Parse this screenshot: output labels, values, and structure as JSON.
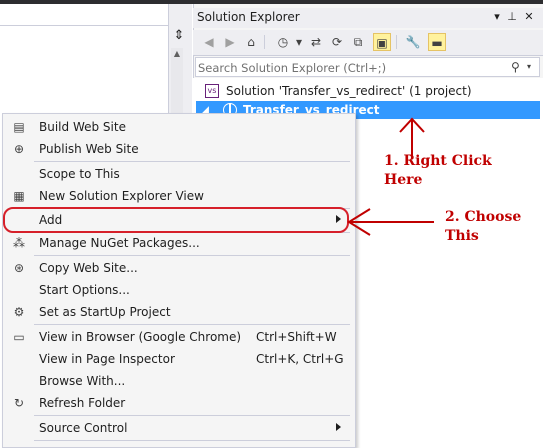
{
  "solution_explorer": {
    "title": "Solution Explorer",
    "search_placeholder": "Search Solution Explorer (Ctrl+;)",
    "tree": {
      "solution_label": "Solution 'Transfer_vs_redirect' (1 project)",
      "project_label": "Transfer_vs_redirect"
    }
  },
  "context_menu": {
    "items": [
      {
        "label": "Build Web Site",
        "icon": "build-icon"
      },
      {
        "label": "Publish Web Site",
        "icon": "publish-icon"
      },
      {
        "label": "Scope to This"
      },
      {
        "label": "New Solution Explorer View",
        "icon": "new-view-icon"
      },
      {
        "label": "Add",
        "submenu": true
      },
      {
        "label": "Manage NuGet Packages...",
        "icon": "nuget-icon"
      },
      {
        "label": "Copy Web Site...",
        "icon": "copy-web-icon"
      },
      {
        "label": "Start Options..."
      },
      {
        "label": "Set as StartUp Project",
        "icon": "gear-icon"
      },
      {
        "label": "View in Browser (Google Chrome)",
        "shortcut": "Ctrl+Shift+W",
        "icon": "browser-icon"
      },
      {
        "label": "View in Page Inspector",
        "shortcut": "Ctrl+K, Ctrl+G"
      },
      {
        "label": "Browse With..."
      },
      {
        "label": "Refresh Folder",
        "icon": "refresh-icon"
      },
      {
        "label": "Source Control",
        "submenu": true
      }
    ]
  },
  "annotations": {
    "right_click_line1": "1. Right Click",
    "right_click_line2": "Here",
    "choose_line1": "2. Choose",
    "choose_line2": "This"
  },
  "colors": {
    "selection": "#3399ff",
    "annotation": "#c00000",
    "highlight_box": "#d6202a"
  }
}
